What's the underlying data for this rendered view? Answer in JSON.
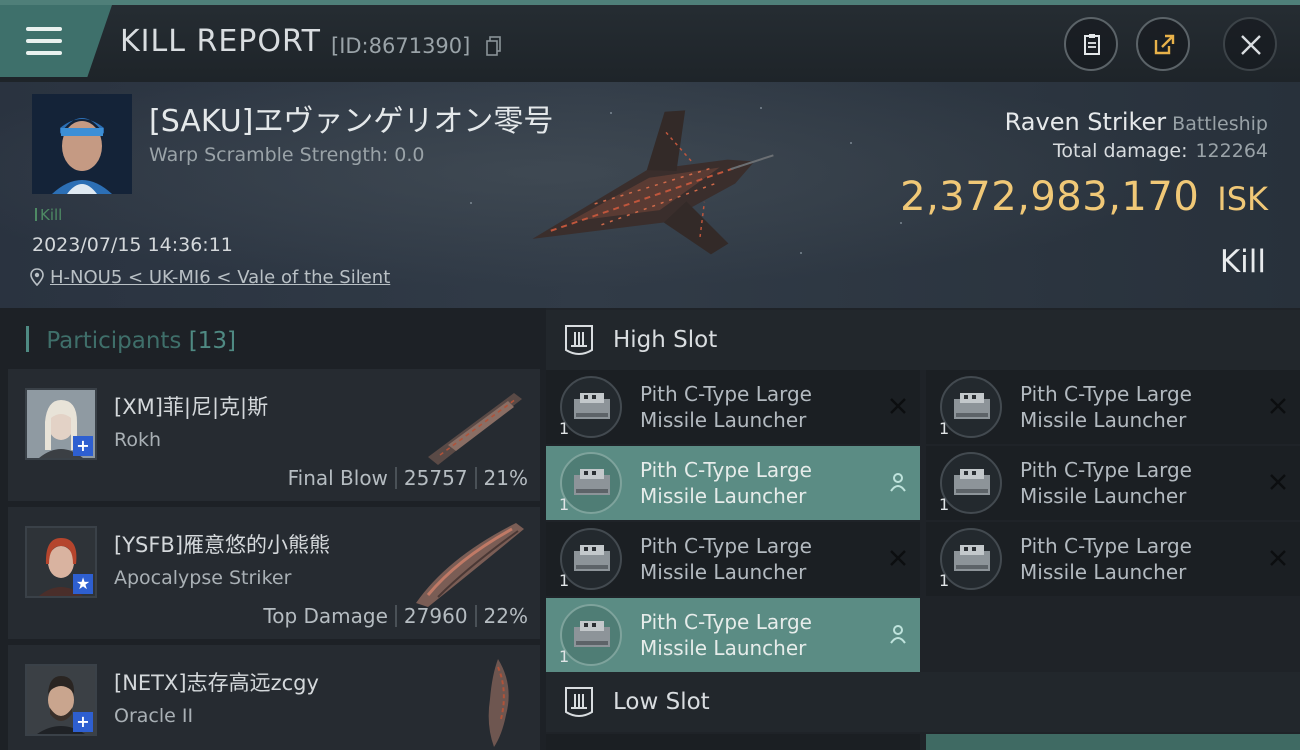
{
  "header": {
    "title": "KILL REPORT",
    "report_id": "[ID:8671390]"
  },
  "icons": {
    "menu": "hamburger-menu-icon",
    "copy": "copy-icon",
    "clipboard": "clipboard-icon",
    "share": "share-icon",
    "close": "close-icon",
    "location": "location-pin-icon",
    "slot": "turret-slot-icon",
    "destroyed": "x-mark-icon",
    "dropped": "person-icon"
  },
  "victim": {
    "name": "[SAKU]ヱヴァンゲリオン零号",
    "warp_scramble": "Warp Scramble Strength: 0.0",
    "tag": "Kill",
    "datetime": "2023/07/15 14:36:11",
    "location": "H-NOU5 < UK-MI6 < Vale of the Silent",
    "ship_name": "Raven Striker",
    "ship_class": "Battleship",
    "total_damage_label": "Total damage:",
    "total_damage": "122264",
    "isk_value": "2,372,983,170",
    "isk_unit": "ISK",
    "result": "Kill"
  },
  "participants": {
    "label": "Participants",
    "count": "[13]",
    "items": [
      {
        "name": "[XM]菲|尼|克|斯",
        "ship": "Rokh",
        "role": "Final Blow",
        "damage": "25757",
        "percent": "21%",
        "badge": "+"
      },
      {
        "name": "[YSFB]雁意悠的小熊熊",
        "ship": "Apocalypse Striker",
        "role": "Top Damage",
        "damage": "27960",
        "percent": "22%",
        "badge": "★"
      },
      {
        "name": "[NETX]志存高远zcgy",
        "ship": "Oracle II",
        "badge": "+"
      }
    ]
  },
  "slots": {
    "high": {
      "title": "High Slot",
      "modules": [
        {
          "name": "Pith C-Type Large Missile Launcher",
          "qty": "1",
          "status": "destroyed"
        },
        {
          "name": "Pith C-Type Large Missile Launcher",
          "qty": "1",
          "status": "destroyed"
        },
        {
          "name": "Pith C-Type Large Missile Launcher",
          "qty": "1",
          "status": "dropped"
        },
        {
          "name": "Pith C-Type Large Missile Launcher",
          "qty": "1",
          "status": "destroyed"
        },
        {
          "name": "Pith C-Type Large Missile Launcher",
          "qty": "1",
          "status": "destroyed"
        },
        {
          "name": "Pith C-Type Large Missile Launcher",
          "qty": "1",
          "status": "destroyed"
        },
        {
          "name": "Pith C-Type Large Missile Launcher",
          "qty": "1",
          "status": "dropped"
        }
      ]
    },
    "low": {
      "title": "Low Slot"
    }
  },
  "colors": {
    "accent_teal": "#4f7f79",
    "isk_gold": "#f0c877",
    "dropped_highlight": "#5b8c84",
    "badge_blue": "#2e5fd0"
  }
}
